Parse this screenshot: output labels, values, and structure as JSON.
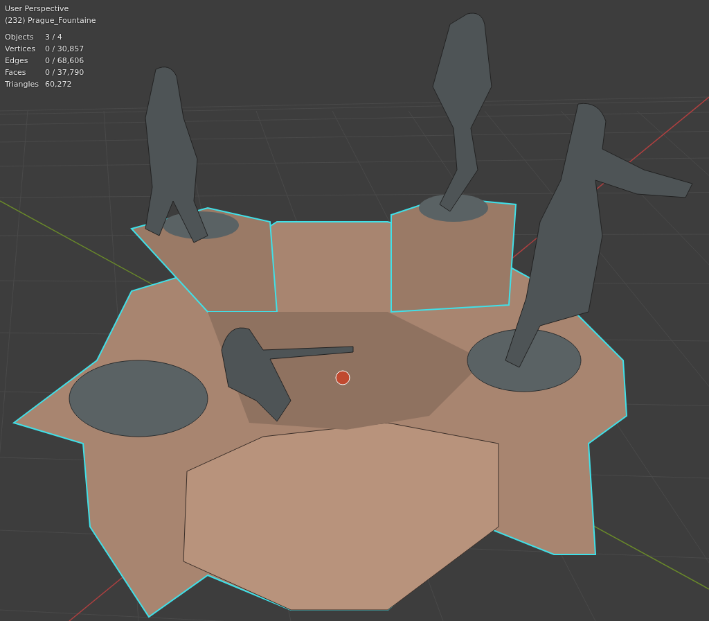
{
  "viewport": {
    "view_name": "User Perspective",
    "object_name": "(232) Prague_Fountaine",
    "stats": [
      {
        "label": "Objects",
        "value": "3 / 4"
      },
      {
        "label": "Vertices",
        "value": "0 / 30,857"
      },
      {
        "label": "Edges",
        "value": "0 / 68,606"
      },
      {
        "label": "Faces",
        "value": "0 / 37,790"
      },
      {
        "label": "Triangles",
        "value": "60,272"
      }
    ]
  }
}
